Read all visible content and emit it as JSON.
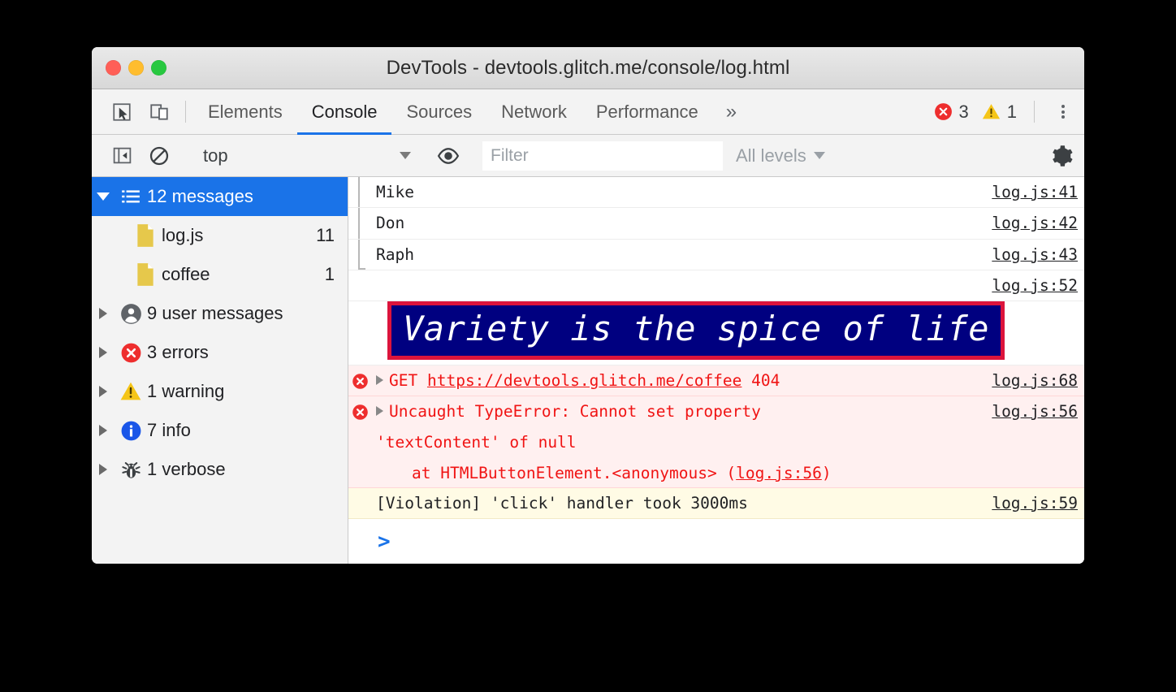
{
  "window": {
    "title": "DevTools - devtools.glitch.me/console/log.html",
    "traffic_lights": [
      "close-button",
      "minimize-button",
      "maximize-button"
    ]
  },
  "tabbar": {
    "inspect_icon": "inspect-element-icon",
    "device_icon": "device-toolbar-icon",
    "tabs": [
      {
        "label": "Elements",
        "active": false
      },
      {
        "label": "Console",
        "active": true
      },
      {
        "label": "Sources",
        "active": false
      },
      {
        "label": "Network",
        "active": false
      },
      {
        "label": "Performance",
        "active": false
      }
    ],
    "more_tabs": "»",
    "error_count": "3",
    "warning_count": "1",
    "kebab_icon": "more-options-icon",
    "error_color": "#ee2e2e",
    "warning_color": "#f5c518"
  },
  "filterbar": {
    "sidebar_toggle_icon": "show-console-sidebar-icon",
    "clear_icon": "clear-console-icon",
    "context": "top",
    "eye_icon": "live-expression-icon",
    "filter_placeholder": "Filter",
    "filter_value": "",
    "levels": "All levels",
    "settings_icon": "settings-gear-icon"
  },
  "sidebar": {
    "items": [
      {
        "label": "12 messages",
        "count": "",
        "icon": "list-icon",
        "expanded": true,
        "selected": true,
        "child": false
      },
      {
        "label": "log.js",
        "count": "11",
        "icon": "file-icon",
        "expanded": false,
        "selected": false,
        "child": true
      },
      {
        "label": "coffee",
        "count": "1",
        "icon": "file-icon",
        "expanded": false,
        "selected": false,
        "child": true
      },
      {
        "label": "9 user messages",
        "count": "",
        "icon": "user-icon",
        "expanded": false,
        "selected": false,
        "child": false
      },
      {
        "label": "3 errors",
        "count": "",
        "icon": "error-icon",
        "expanded": false,
        "selected": false,
        "child": false
      },
      {
        "label": "1 warning",
        "count": "",
        "icon": "warning-icon",
        "expanded": false,
        "selected": false,
        "child": false
      },
      {
        "label": "7 info",
        "count": "",
        "icon": "info-icon",
        "expanded": false,
        "selected": false,
        "child": false
      },
      {
        "label": "1 verbose",
        "count": "",
        "icon": "bug-icon",
        "expanded": false,
        "selected": false,
        "child": false
      }
    ]
  },
  "console": {
    "messages": [
      {
        "text": "Mike",
        "source": "log.js:41",
        "level": "log",
        "grouped": true,
        "group_last": false
      },
      {
        "text": "Don",
        "source": "log.js:42",
        "level": "log",
        "grouped": true,
        "group_last": false
      },
      {
        "text": "Raph",
        "source": "log.js:43",
        "level": "log",
        "grouped": true,
        "group_last": true
      },
      {
        "text": "",
        "source": "log.js:52",
        "level": "log",
        "grouped": false,
        "group_last": false
      }
    ],
    "styled_message": {
      "text": "Variety is the spice of life",
      "source": "log.js:52",
      "background": "#000080",
      "border_color": "#dc143c",
      "text_color": "#ffffff"
    },
    "network_error": {
      "method": "GET",
      "url": "https://devtools.glitch.me/coffee",
      "status": "404",
      "source": "log.js:68"
    },
    "type_error": {
      "line1": "Uncaught TypeError: Cannot set property",
      "line2": "'textContent' of null",
      "line3_prefix": "at HTMLButtonElement.<anonymous> (",
      "line3_link": "log.js:56",
      "line3_suffix": ")",
      "source": "log.js:56"
    },
    "violation": {
      "text": "[Violation] 'click' handler took 3000ms",
      "source": "log.js:59"
    },
    "prompt": ">"
  }
}
